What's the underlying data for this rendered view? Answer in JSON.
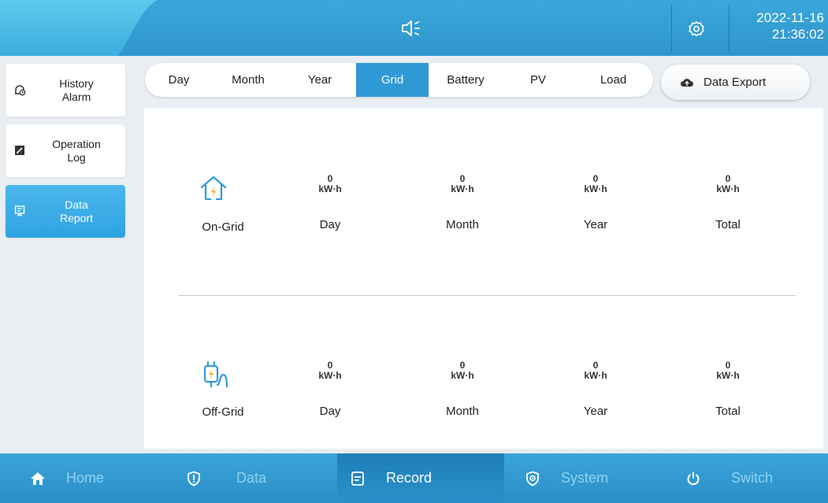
{
  "header": {
    "date": "2022-11-16",
    "time": "21:36:02",
    "speaker_icon": "speaker-icon",
    "settings_icon": "gear-icon",
    "colors": {
      "bar": "#2f95cc",
      "accent": "#5fc9ee"
    }
  },
  "sidebar": {
    "items": [
      {
        "label": "History\nAlarm",
        "icon": "alarm-clock-icon",
        "active": false
      },
      {
        "label": "Operation\nLog",
        "icon": "log-icon",
        "active": false
      },
      {
        "label": "Data\nReport",
        "icon": "report-icon",
        "active": true
      }
    ]
  },
  "tabs": [
    {
      "label": "Day",
      "active": false
    },
    {
      "label": "Month",
      "active": false
    },
    {
      "label": "Year",
      "active": false
    },
    {
      "label": "Grid",
      "active": true
    },
    {
      "label": "Battery",
      "active": false
    },
    {
      "label": "PV",
      "active": false
    },
    {
      "label": "Load",
      "active": false
    }
  ],
  "export_button": {
    "label": "Data Export",
    "icon": "cloud-upload-icon"
  },
  "grid_report": {
    "on_grid": {
      "title": "On-Grid",
      "icon": "house-lightning-icon",
      "stats": [
        {
          "value": "0",
          "unit": "kW·h",
          "label": "Day"
        },
        {
          "value": "0",
          "unit": "kW·h",
          "label": "Month"
        },
        {
          "value": "0",
          "unit": "kW·h",
          "label": "Year"
        },
        {
          "value": "0",
          "unit": "kW·h",
          "label": "Total"
        }
      ]
    },
    "off_grid": {
      "title": "Off-Grid",
      "icon": "plug-lightning-icon",
      "stats": [
        {
          "value": "0",
          "unit": "kW·h",
          "label": "Day"
        },
        {
          "value": "0",
          "unit": "kW·h",
          "label": "Month"
        },
        {
          "value": "0",
          "unit": "kW·h",
          "label": "Year"
        },
        {
          "value": "0",
          "unit": "kW·h",
          "label": "Total"
        }
      ]
    }
  },
  "bottom_nav": [
    {
      "label": "Home",
      "icon": "home-icon",
      "active": false
    },
    {
      "label": "Data",
      "icon": "shield-alert-icon",
      "active": false
    },
    {
      "label": "Record",
      "icon": "record-icon",
      "active": true
    },
    {
      "label": "System",
      "icon": "settings-shield-icon",
      "active": false
    },
    {
      "label": "Switch",
      "icon": "power-icon",
      "active": false
    }
  ]
}
